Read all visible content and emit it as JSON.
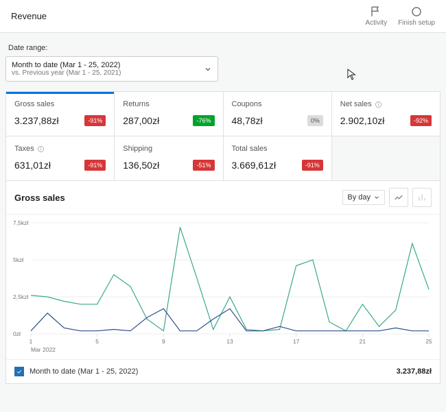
{
  "header": {
    "title": "Revenue",
    "activity_label": "Activity",
    "finish_setup_label": "Finish setup"
  },
  "date_range": {
    "label": "Date range:",
    "main": "Month to date (Mar 1 - 25, 2022)",
    "sub": "vs. Previous year (Mar 1 - 25, 2021)"
  },
  "metrics": [
    {
      "label": "Gross sales",
      "value": "3.237,88zł",
      "delta": "-91%",
      "delta_kind": "red",
      "active": true,
      "info": false
    },
    {
      "label": "Returns",
      "value": "287,00zł",
      "delta": "-76%",
      "delta_kind": "green",
      "info": false
    },
    {
      "label": "Coupons",
      "value": "48,78zł",
      "delta": "0%",
      "delta_kind": "gray",
      "info": false
    },
    {
      "label": "Net sales",
      "value": "2.902,10zł",
      "delta": "-92%",
      "delta_kind": "red",
      "info": true
    },
    {
      "label": "Taxes",
      "value": "631,01zł",
      "delta": "-91%",
      "delta_kind": "red",
      "info": true
    },
    {
      "label": "Shipping",
      "value": "136,50zł",
      "delta": "-51%",
      "delta_kind": "red",
      "info": false
    },
    {
      "label": "Total sales",
      "value": "3.669,61zł",
      "delta": "-91%",
      "delta_kind": "red",
      "info": false
    }
  ],
  "chart": {
    "title": "Gross sales",
    "by_label": "By day",
    "x_axis_title": "Mar 2022",
    "legend_label": "Month to date (Mar 1 - 25, 2022)",
    "legend_value": "3.237,88zł"
  },
  "chart_data": {
    "type": "line",
    "xlabel": "Mar 2022",
    "ylabel": "",
    "ylim": [
      0,
      7500
    ],
    "y_ticks": [
      "0zł",
      "2,5kzł",
      "5kzł",
      "7,5kzł"
    ],
    "x_ticks": [
      "1",
      "5",
      "9",
      "13",
      "17",
      "21",
      "25"
    ],
    "categories": [
      1,
      2,
      3,
      4,
      5,
      6,
      7,
      8,
      9,
      10,
      11,
      12,
      13,
      14,
      15,
      16,
      17,
      18,
      19,
      20,
      21,
      22,
      23,
      24,
      25
    ],
    "series": [
      {
        "name": "Month to date (Mar 1 - 25, 2022)",
        "values": [
          2600,
          2500,
          2200,
          2000,
          2000,
          4000,
          3200,
          1000,
          200,
          7200,
          3800,
          300,
          2500,
          300,
          200,
          300,
          4600,
          5000,
          800,
          200,
          2000,
          500,
          1600,
          6100,
          3000
        ]
      },
      {
        "name": "Previous year (Mar 1 - 25, 2021)",
        "values": [
          200,
          1400,
          400,
          200,
          200,
          300,
          200,
          1100,
          1700,
          200,
          200,
          1000,
          1700,
          200,
          200,
          500,
          200,
          200,
          200,
          200,
          200,
          200,
          400,
          200,
          200
        ]
      }
    ]
  }
}
